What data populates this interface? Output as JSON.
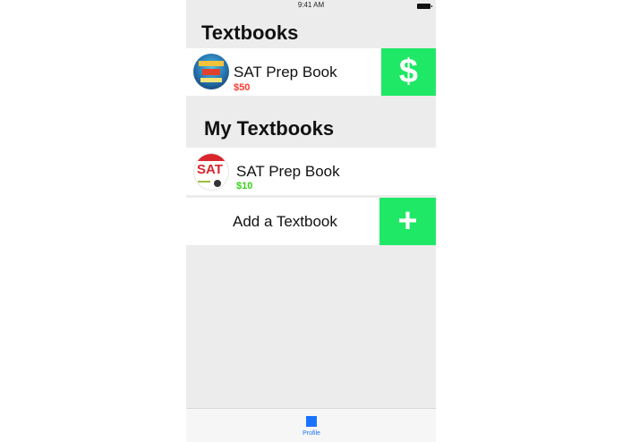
{
  "status_bar": {
    "time": "9:41 AM"
  },
  "sections": {
    "textbooks_title": "Textbooks",
    "my_textbooks_title": "My Textbooks"
  },
  "textbooks": [
    {
      "title": "SAT Prep Book",
      "price": "$50",
      "price_color": "#ff3b30",
      "action_glyph": "$"
    }
  ],
  "my_textbooks": [
    {
      "title": "SAT Prep Book",
      "price": "$10",
      "price_color": "#34d317"
    }
  ],
  "add_textbook": {
    "label": "Add a Textbook",
    "glyph": "+"
  },
  "tab_bar": {
    "items": [
      {
        "label": "Profile",
        "icon": "profile-icon"
      }
    ]
  },
  "colors": {
    "accent_green": "#1ee866",
    "tab_blue": "#1a73ff",
    "background": "#ececec"
  }
}
